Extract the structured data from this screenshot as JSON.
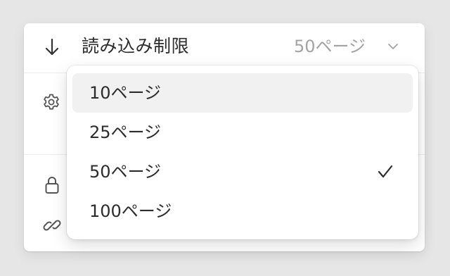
{
  "settings": {
    "load_limit_label": "読み込み制限",
    "load_limit_value": "50ページ"
  },
  "dropdown": {
    "options": [
      {
        "label": "10ページ",
        "highlighted": true,
        "selected": false
      },
      {
        "label": "25ページ",
        "highlighted": false,
        "selected": false
      },
      {
        "label": "50ページ",
        "highlighted": false,
        "selected": true
      },
      {
        "label": "100ページ",
        "highlighted": false,
        "selected": false
      }
    ]
  },
  "icons": {
    "row_icon": "arrow-down-icon",
    "value_chevron": "chevron-down-icon",
    "settings_icon": "gear-icon",
    "privacy_icon": "lock-icon",
    "link_icon": "link-icon",
    "selected_marker": "checkmark-icon"
  },
  "colors": {
    "page_background": "#e6e6e6",
    "panel_background": "#ffffff",
    "text_primary": "#2c2c2c",
    "text_secondary": "#a3a3a3",
    "highlight_background": "#f1f1f1"
  }
}
